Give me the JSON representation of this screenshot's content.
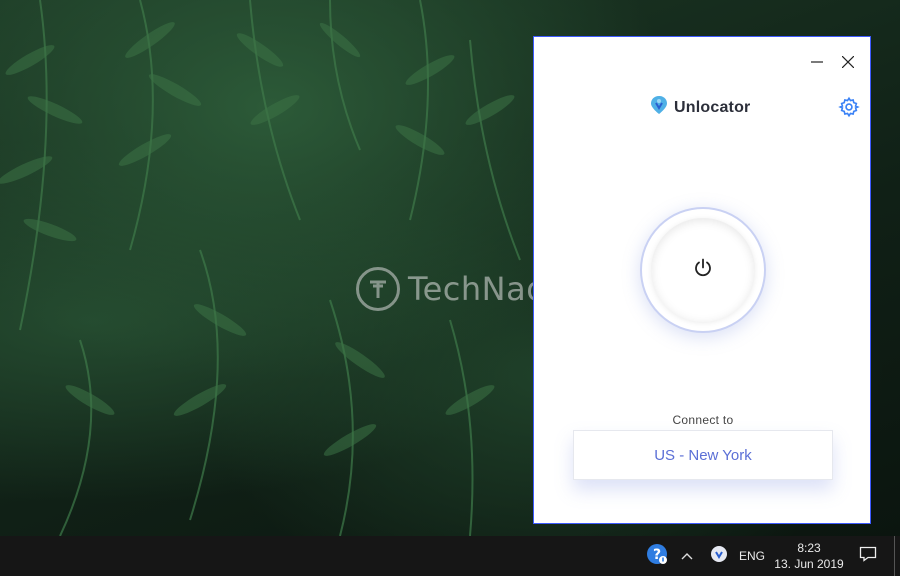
{
  "desktop": {
    "watermark_text": "TechNadu"
  },
  "app": {
    "name": "Unlocator",
    "window_controls": {
      "minimize_icon": "minimize-icon",
      "close_icon": "close-icon"
    },
    "settings_icon": "gear-icon",
    "power_icon": "power-icon",
    "connect_label": "Connect to",
    "location": "US - New York",
    "colors": {
      "accent": "#5b6fd6",
      "border": "#3d5afe",
      "brand_text": "#2c2f3a"
    }
  },
  "taskbar": {
    "tray": {
      "help_icon": "help-icon",
      "chevron_icon": "chevron-up-icon",
      "unlocator_tray_icon": "unlocator-tray-icon",
      "language": "ENG",
      "notification_icon": "notification-icon"
    },
    "clock": {
      "time": "8:23",
      "date": "13. Jun 2019"
    }
  }
}
